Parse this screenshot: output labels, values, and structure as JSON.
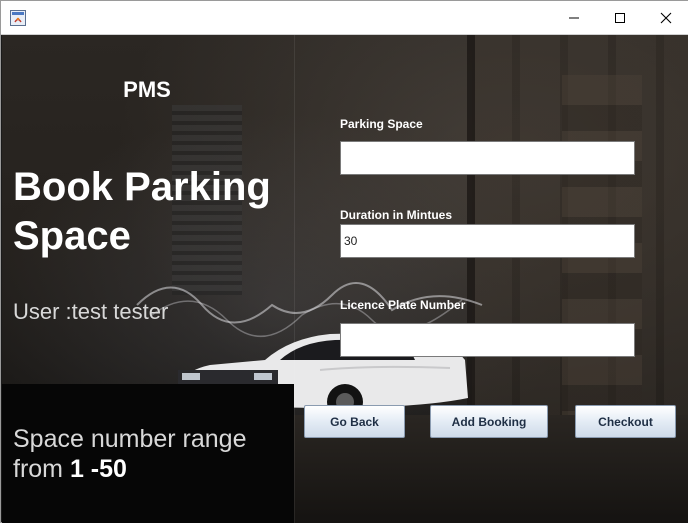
{
  "window": {
    "title": "",
    "icon": "java-app-icon",
    "controls": [
      "minimize-icon",
      "maximize-icon",
      "close-icon"
    ]
  },
  "left_panel": {
    "app_name": "PMS",
    "heading_line1": "Book Parking",
    "heading_line2": "Space",
    "user_text": "User :test tester",
    "range_prefix": "Space number range",
    "range_from": "from",
    "range_value": "1 -50"
  },
  "form": {
    "parking_space": {
      "label": "Parking Space",
      "value": ""
    },
    "duration": {
      "label": "Duration in Mintues",
      "value": "30"
    },
    "licence_plate": {
      "label": "Licence Plate Number",
      "value": ""
    }
  },
  "buttons": {
    "go_back": "Go Back",
    "add_booking": "Add Booking",
    "checkout": "Checkout"
  }
}
